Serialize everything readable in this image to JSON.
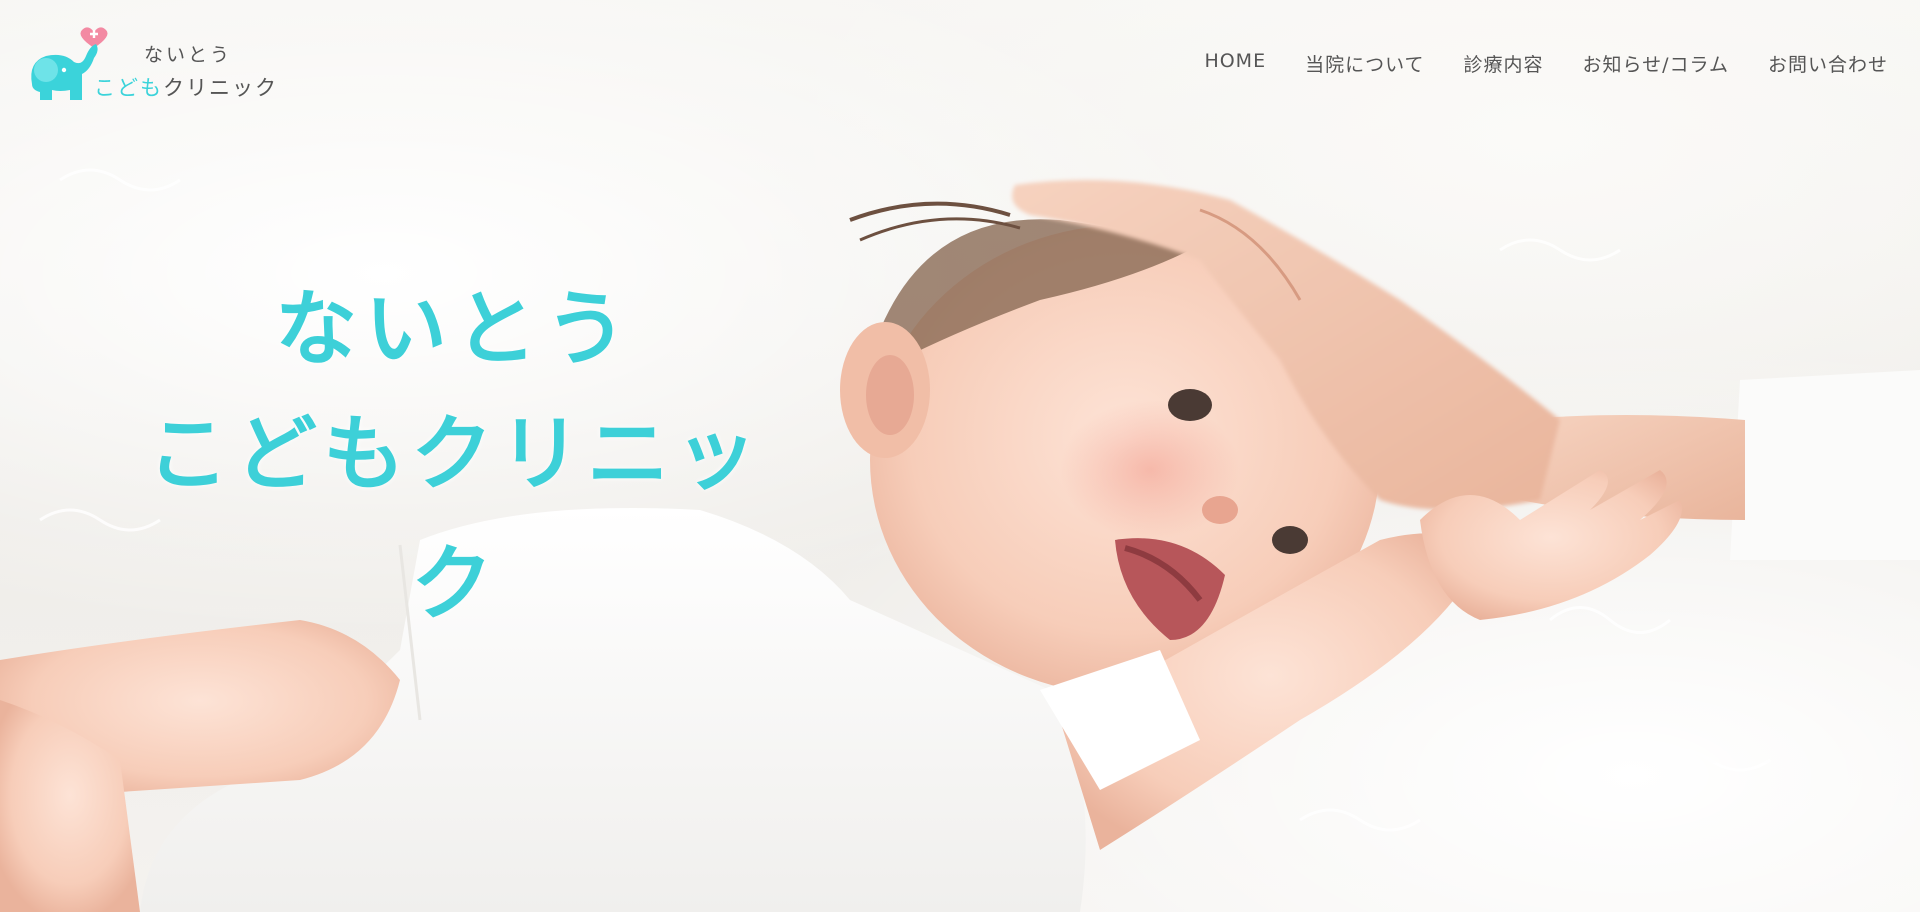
{
  "brand": {
    "logo_line1": "ないとう",
    "logo_line2_colored": "こども",
    "logo_line2_plain": "クリニック",
    "colors": {
      "accent": "#3bd3da",
      "pink": "#f38aa3",
      "text": "#555555"
    },
    "icon": "elephant-with-heart-icon"
  },
  "nav": {
    "items": [
      {
        "label": "HOME"
      },
      {
        "label": "当院について"
      },
      {
        "label": "診療内容"
      },
      {
        "label": "お知らせ/コラム"
      },
      {
        "label": "お問い合わせ"
      }
    ]
  },
  "hero": {
    "title_line1": "ないとう",
    "title_line2": "こどもクリニック",
    "image": "smiling-baby-on-white-fur-photo"
  }
}
